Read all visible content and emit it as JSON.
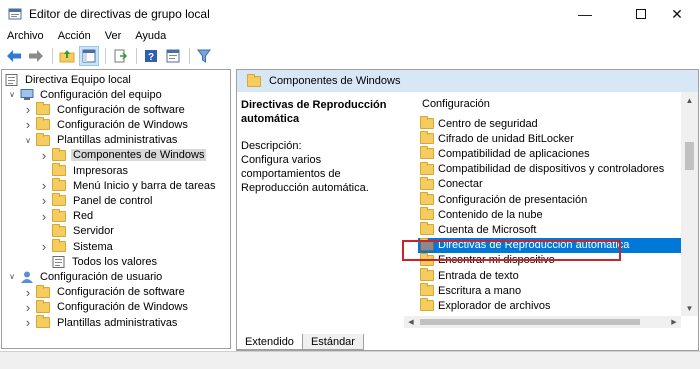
{
  "window": {
    "title": "Editor de directivas de grupo local",
    "controls": [
      "minimize-icon",
      "maximize-icon",
      "close-icon"
    ]
  },
  "menu": [
    "Archivo",
    "Acción",
    "Ver",
    "Ayuda"
  ],
  "toolbar_icons": [
    "back-arrow-icon",
    "forward-arrow-icon",
    "up-folder-icon",
    "show-hide-tree-icon",
    "export-list-icon",
    "help-icon",
    "properties-icon",
    "filter-icon"
  ],
  "tree": {
    "root": "Directiva Equipo local",
    "items": [
      {
        "label": "Configuración del equipo",
        "level": 1,
        "expander": "open",
        "icon": "computer-icon"
      },
      {
        "label": "Configuración de software",
        "level": 2,
        "expander": "closed",
        "icon": "folder-icon"
      },
      {
        "label": "Configuración de Windows",
        "level": 2,
        "expander": "closed",
        "icon": "folder-icon"
      },
      {
        "label": "Plantillas administrativas",
        "level": 2,
        "expander": "open",
        "icon": "folder-icon"
      },
      {
        "label": "Componentes de Windows",
        "level": 3,
        "expander": "closed",
        "icon": "folder-icon",
        "selected": true
      },
      {
        "label": "Impresoras",
        "level": 3,
        "expander": "none",
        "icon": "folder-icon"
      },
      {
        "label": "Menú Inicio y barra de tareas",
        "level": 3,
        "expander": "closed",
        "icon": "folder-icon"
      },
      {
        "label": "Panel de control",
        "level": 3,
        "expander": "closed",
        "icon": "folder-icon"
      },
      {
        "label": "Red",
        "level": 3,
        "expander": "closed",
        "icon": "folder-icon"
      },
      {
        "label": "Servidor",
        "level": 3,
        "expander": "none",
        "icon": "folder-icon"
      },
      {
        "label": "Sistema",
        "level": 3,
        "expander": "closed",
        "icon": "folder-icon"
      },
      {
        "label": "Todos los valores",
        "level": 3,
        "expander": "none",
        "icon": "settings-list-icon"
      },
      {
        "label": "Configuración de usuario",
        "level": 1,
        "expander": "open",
        "icon": "user-icon"
      },
      {
        "label": "Configuración de software",
        "level": 2,
        "expander": "closed",
        "icon": "folder-icon"
      },
      {
        "label": "Configuración de Windows",
        "level": 2,
        "expander": "closed",
        "icon": "folder-icon"
      },
      {
        "label": "Plantillas administrativas",
        "level": 2,
        "expander": "closed",
        "icon": "folder-icon"
      }
    ]
  },
  "right_pane": {
    "header": "Componentes de Windows",
    "description": {
      "heading": "Directivas de Reproducción automática",
      "label": "Descripción:",
      "text": "Configura varios comportamientos de Reproducción automática."
    },
    "column_header": "Configuración",
    "items": [
      "Centro de seguridad",
      "Cifrado de unidad BitLocker",
      "Compatibilidad de aplicaciones",
      "Compatibilidad de dispositivos y controladores",
      "Conectar",
      "Configuración de presentación",
      "Contenido de la nube",
      "Cuenta de Microsoft",
      "Directivas de Reproducción automática",
      "Encontrar mi dispositivo",
      "Entrada de texto",
      "Escritura a mano",
      "Explorador de archivos"
    ],
    "selected_item": "Directivas de Reproducción automática"
  },
  "tabs": [
    "Extendido",
    "Estándar"
  ],
  "active_tab": "Extendido",
  "colors": {
    "selection": "#0078d7",
    "header_band": "#d8e7f5",
    "annotation_box": "#c8242a",
    "folder": "#f4cd5e"
  }
}
